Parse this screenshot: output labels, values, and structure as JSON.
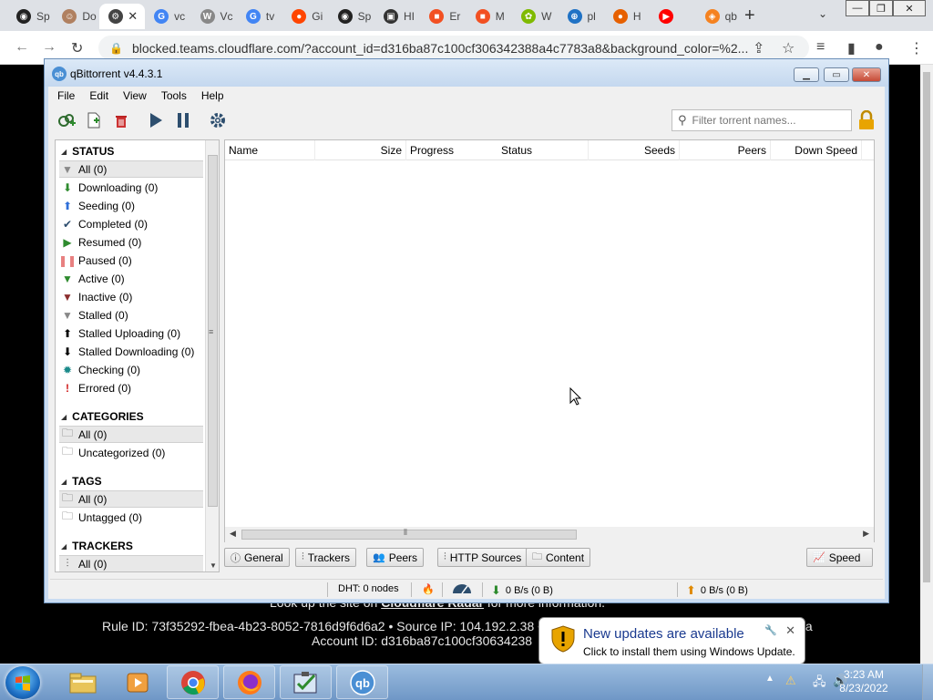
{
  "browser": {
    "tabs": [
      {
        "label": "Sp",
        "color": "#222222",
        "glyph": "◉"
      },
      {
        "label": "Do",
        "color": "#b08060",
        "glyph": "☺"
      },
      {
        "label": "",
        "color": "#444444",
        "glyph": "⚙",
        "active": true
      },
      {
        "label": "vc",
        "color": "#4285f4",
        "glyph": "G"
      },
      {
        "label": "Vc",
        "color": "#888888",
        "glyph": "W"
      },
      {
        "label": "tv",
        "color": "#4285f4",
        "glyph": "G"
      },
      {
        "label": "Gi",
        "color": "#ff4500",
        "glyph": "●"
      },
      {
        "label": "Sp",
        "color": "#222222",
        "glyph": "◉"
      },
      {
        "label": "HI",
        "color": "#333333",
        "glyph": "▣"
      },
      {
        "label": "Er",
        "color": "#f25022",
        "glyph": "■"
      },
      {
        "label": "M",
        "color": "#f25022",
        "glyph": "■"
      },
      {
        "label": "W",
        "color": "#7fba00",
        "glyph": "✿"
      },
      {
        "label": "pl",
        "color": "#1f72c5",
        "glyph": "⊕"
      },
      {
        "label": "H",
        "color": "#e66000",
        "glyph": "●"
      },
      {
        "label": "",
        "color": "#ff0000",
        "glyph": "▶"
      },
      {
        "label": "qb",
        "color": "#f58220",
        "glyph": "◈"
      }
    ],
    "url": "blocked.teams.cloudflare.com/?account_id=d316ba87c100cf306342388a4c7783a8&background_color=%2..."
  },
  "cloudflare": {
    "lookup_line": "Look up the site on",
    "lookup_link": "Cloudflare Radar",
    "lookup_tail": "for more information.",
    "rule_line": "Rule ID: 73f35292-fbea-4b23-8052-7816d9f6d6a2 • Source IP: 104.192.2.38 •",
    "rule_tail": "fa",
    "account_line": "Account ID: d316ba87c100cf30634238"
  },
  "qbittorrent": {
    "title": "qBittorrent v4.4.3.1",
    "menu": [
      "File",
      "Edit",
      "View",
      "Tools",
      "Help"
    ],
    "filter_placeholder": "Filter torrent names...",
    "sections": {
      "status": "STATUS",
      "categories": "CATEGORIES",
      "tags": "TAGS",
      "trackers": "TRACKERS"
    },
    "status_items": [
      "All (0)",
      "Downloading (0)",
      "Seeding (0)",
      "Completed (0)",
      "Resumed (0)",
      "Paused (0)",
      "Active (0)",
      "Inactive (0)",
      "Stalled (0)",
      "Stalled Uploading (0)",
      "Stalled Downloading (0)",
      "Checking (0)",
      "Errored (0)"
    ],
    "category_items": [
      "All (0)",
      "Uncategorized (0)"
    ],
    "tag_items": [
      "All (0)",
      "Untagged (0)"
    ],
    "tracker_items": [
      "All (0)"
    ],
    "columns": [
      "Name",
      "Size",
      "Progress",
      "Status",
      "Seeds",
      "Peers",
      "Down Speed"
    ],
    "property_tabs": [
      "General",
      "Trackers",
      "Peers",
      "HTTP Sources",
      "Content"
    ],
    "speed_button": "Speed",
    "statusbar": {
      "dht": "DHT: 0 nodes",
      "down": "0 B/s (0 B)",
      "up": "0 B/s (0 B)"
    }
  },
  "notification": {
    "title": "New updates are available",
    "subtitle": "Click to install them using Windows Update."
  },
  "taskbar": {
    "time": "3:23 AM",
    "date": "8/23/2022"
  },
  "colors": {
    "accent_blue": "#1a3a8f",
    "download_green": "#2e8b2e",
    "upload_orange": "#e08a00",
    "seeding_blue": "#2f6fd8",
    "error_red": "#d02020"
  }
}
